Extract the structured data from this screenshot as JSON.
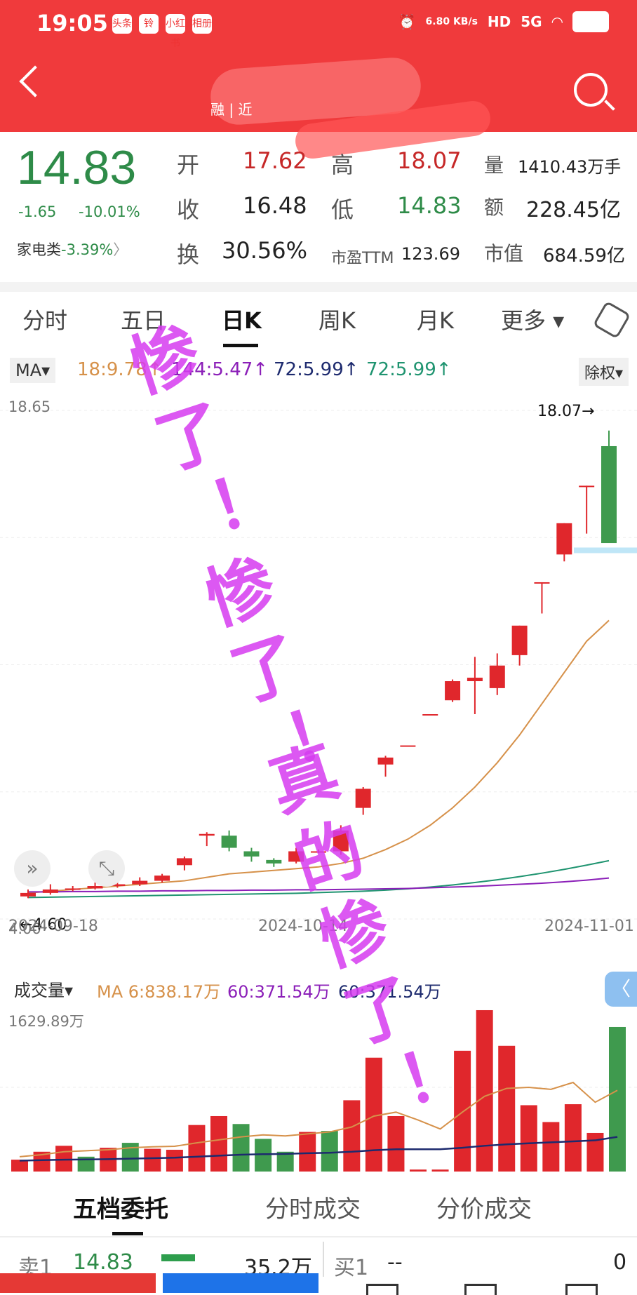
{
  "status_bar": {
    "time": "19:05",
    "net_speed": "6.80 KB/s",
    "hd": "HD",
    "signal": "5G",
    "app_icons": [
      "头条",
      "铃",
      "小红书",
      "相册"
    ]
  },
  "header": {
    "title_text": "融 | 近"
  },
  "quote": {
    "price": "14.83",
    "change": "-1.65",
    "change_pct": "-10.01%",
    "sector": "家电类",
    "sector_chg": "-3.39%",
    "sector_arrow": "〉",
    "open_label": "开",
    "open": "17.62",
    "high_label": "高",
    "high": "18.07",
    "vol_label": "量",
    "vol": "1410.43万手",
    "close_label": "收",
    "close": "16.48",
    "low_label": "低",
    "low": "14.83",
    "amt_label": "额",
    "amt": "228.45亿",
    "turn_label": "换",
    "turn": "30.56%",
    "pe_label": "市盈TTM",
    "pe": "123.69",
    "mcap_label": "市值",
    "mcap": "684.59亿"
  },
  "tabs": [
    {
      "label": "分时"
    },
    {
      "label": "五日"
    },
    {
      "label": "日K"
    },
    {
      "label": "周K"
    },
    {
      "label": "月K"
    },
    {
      "label": "更多 ▾"
    }
  ],
  "ma_bar": {
    "dropdown": "MA▾",
    "ma1": "18:9.78↑",
    "ma2": "144:5.47↑",
    "ma3": "72:5.99↑",
    "ma4": "72:5.99↑",
    "chuquan": "除权▾",
    "colors": {
      "ma1": "#d6914a",
      "ma2": "#8b1fb8",
      "ma3": "#1d2a6e",
      "ma4": "#1f9470"
    }
  },
  "chart_labels": {
    "top": "18.65",
    "bottom": "4.00",
    "max_marker": "18.07→",
    "min_marker": "←4.60",
    "dates": [
      "2024-09-18",
      "2024-10-14",
      "2024-11-01"
    ]
  },
  "chart_data": {
    "type": "candlestick",
    "ylim": [
      4.0,
      18.65
    ],
    "candles": [
      {
        "o": 4.65,
        "c": 4.75,
        "h": 4.85,
        "l": 4.6,
        "dir": "up"
      },
      {
        "o": 4.75,
        "c": 4.85,
        "h": 5.0,
        "l": 4.7,
        "dir": "up"
      },
      {
        "o": 4.85,
        "c": 4.88,
        "h": 4.95,
        "l": 4.8,
        "dir": "up"
      },
      {
        "o": 4.88,
        "c": 4.95,
        "h": 5.05,
        "l": 4.85,
        "dir": "up"
      },
      {
        "o": 4.95,
        "c": 5.0,
        "h": 5.25,
        "l": 4.9,
        "dir": "up"
      },
      {
        "o": 5.0,
        "c": 5.1,
        "h": 5.2,
        "l": 4.95,
        "dir": "up"
      },
      {
        "o": 5.1,
        "c": 5.25,
        "h": 5.3,
        "l": 5.05,
        "dir": "up"
      },
      {
        "o": 5.55,
        "c": 5.75,
        "h": 5.8,
        "l": 5.4,
        "dir": "up"
      },
      {
        "o": 6.4,
        "c": 6.45,
        "h": 6.5,
        "l": 6.1,
        "dir": "up"
      },
      {
        "o": 6.4,
        "c": 6.05,
        "h": 6.55,
        "l": 5.95,
        "dir": "down"
      },
      {
        "o": 5.95,
        "c": 5.8,
        "h": 6.05,
        "l": 5.65,
        "dir": "down"
      },
      {
        "o": 5.7,
        "c": 5.6,
        "h": 5.75,
        "l": 5.5,
        "dir": "down"
      },
      {
        "o": 5.65,
        "c": 5.95,
        "h": 6.05,
        "l": 5.6,
        "dir": "up"
      },
      {
        "o": 5.95,
        "c": 5.95,
        "h": 6.0,
        "l": 5.9,
        "dir": "up"
      },
      {
        "o": 5.95,
        "c": 6.55,
        "h": 6.7,
        "l": 5.85,
        "dir": "up"
      },
      {
        "o": 7.2,
        "c": 7.75,
        "h": 7.8,
        "l": 7.0,
        "dir": "up"
      },
      {
        "o": 8.45,
        "c": 8.65,
        "h": 8.7,
        "l": 8.1,
        "dir": "up"
      },
      {
        "o": 9.0,
        "c": 9.0,
        "h": 9.0,
        "l": 9.0,
        "dir": "up"
      },
      {
        "o": 9.9,
        "c": 9.9,
        "h": 9.9,
        "l": 9.9,
        "dir": "up"
      },
      {
        "o": 10.3,
        "c": 10.85,
        "h": 10.9,
        "l": 10.25,
        "dir": "up"
      },
      {
        "o": 10.85,
        "c": 10.95,
        "h": 11.55,
        "l": 9.9,
        "dir": "up"
      },
      {
        "o": 10.65,
        "c": 11.3,
        "h": 11.65,
        "l": 10.45,
        "dir": "up"
      },
      {
        "o": 11.6,
        "c": 12.45,
        "h": 12.45,
        "l": 11.3,
        "dir": "up"
      },
      {
        "o": 13.7,
        "c": 13.7,
        "h": 13.7,
        "l": 12.8,
        "dir": "up"
      },
      {
        "o": 14.5,
        "c": 15.4,
        "h": 15.4,
        "l": 14.3,
        "dir": "up"
      },
      {
        "o": 16.48,
        "c": 16.48,
        "h": 16.48,
        "l": 15.1,
        "dir": "up"
      },
      {
        "o": 17.62,
        "c": 14.83,
        "h": 18.07,
        "l": 14.83,
        "dir": "down"
      }
    ],
    "ma_series": [
      {
        "color": "#d6914a",
        "values": [
          4.75,
          4.8,
          4.85,
          4.9,
          4.95,
          5.0,
          5.05,
          5.1,
          5.2,
          5.3,
          5.35,
          5.4,
          5.45,
          5.5,
          5.6,
          5.75,
          6.0,
          6.3,
          6.7,
          7.2,
          7.8,
          8.5,
          9.3,
          10.2,
          11.1,
          12.0,
          12.6
        ]
      },
      {
        "color": "#1f9470",
        "values": [
          4.62,
          4.63,
          4.64,
          4.65,
          4.66,
          4.67,
          4.68,
          4.69,
          4.7,
          4.71,
          4.72,
          4.73,
          4.74,
          4.76,
          4.78,
          4.8,
          4.83,
          4.87,
          4.92,
          4.98,
          5.05,
          5.13,
          5.22,
          5.32,
          5.43,
          5.55,
          5.68
        ]
      },
      {
        "color": "#8b1fb8",
        "values": [
          4.78,
          4.78,
          4.79,
          4.79,
          4.8,
          4.8,
          4.81,
          4.81,
          4.82,
          4.82,
          4.83,
          4.83,
          4.84,
          4.84,
          4.85,
          4.86,
          4.87,
          4.88,
          4.9,
          4.92,
          4.94,
          4.97,
          5.0,
          5.03,
          5.07,
          5.12,
          5.18
        ]
      }
    ],
    "volume": {
      "ylim": [
        0,
        1629.89
      ],
      "values": [
        120,
        200,
        260,
        150,
        240,
        290,
        230,
        220,
        470,
        560,
        480,
        330,
        200,
        400,
        410,
        720,
        1150,
        560,
        20,
        20,
        1220,
        1630,
        1270,
        670,
        500,
        680,
        390,
        1460
      ],
      "dirs": [
        "up",
        "up",
        "up",
        "down",
        "up",
        "down",
        "up",
        "up",
        "up",
        "up",
        "down",
        "down",
        "down",
        "up",
        "down",
        "up",
        "up",
        "up",
        "up",
        "up",
        "up",
        "up",
        "up",
        "up",
        "up",
        "up",
        "up",
        "down"
      ],
      "ma1": [
        150,
        170,
        200,
        210,
        220,
        240,
        250,
        255,
        290,
        320,
        350,
        370,
        360,
        380,
        400,
        450,
        560,
        600,
        520,
        430,
        600,
        760,
        840,
        850,
        830,
        900,
        700,
        820
      ],
      "ma2": [
        110,
        115,
        120,
        122,
        125,
        130,
        135,
        140,
        150,
        160,
        170,
        175,
        178,
        185,
        190,
        200,
        215,
        225,
        225,
        225,
        240,
        260,
        275,
        285,
        295,
        305,
        315,
        350
      ]
    }
  },
  "volume_bar": {
    "dropdown": "成交量▾",
    "ma1": "MA 6:838.17万",
    "ma2": "60:371.54万",
    "ma3": "60:371.54万",
    "top_label": "1629.89万",
    "side_tab": "〈"
  },
  "bottom_tabs": [
    {
      "label": "五档委托"
    },
    {
      "label": "分时成交"
    },
    {
      "label": "分价成交"
    }
  ],
  "orderbook": {
    "sell_label": "卖1",
    "sell_price": "14.83",
    "sell_vol": "35.2万",
    "buy_label": "买1",
    "buy_price": "--",
    "buy_vol": "0"
  },
  "overlay_text": {
    "line1": "惨了！惨了！",
    "line2": "真的惨了！"
  }
}
